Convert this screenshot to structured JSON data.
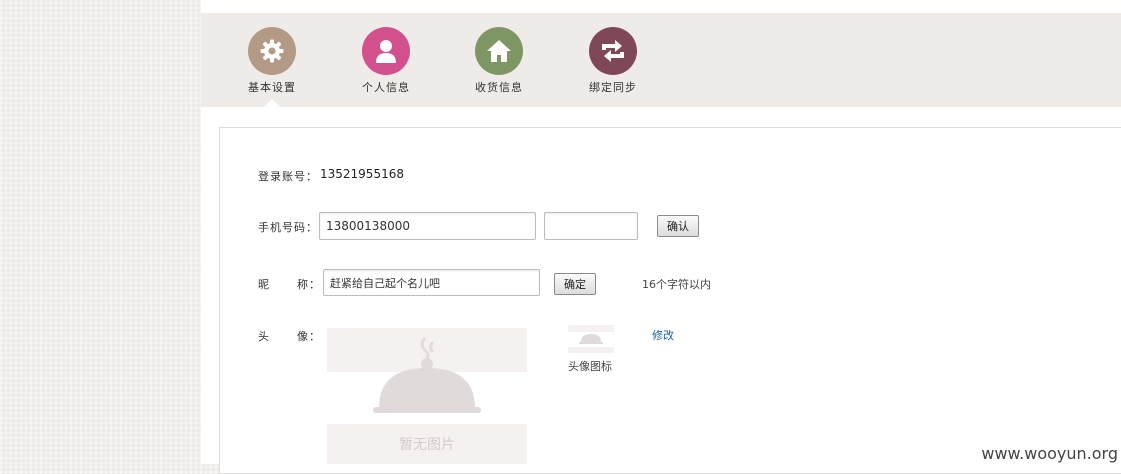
{
  "nav": {
    "items": [
      {
        "label": "基本设置",
        "icon": "gear-icon",
        "color": "#b29a86"
      },
      {
        "label": "个人信息",
        "icon": "user-icon",
        "color": "#d2508c"
      },
      {
        "label": "收货信息",
        "icon": "home-icon",
        "color": "#7d9663"
      },
      {
        "label": "绑定同步",
        "icon": "sync-icon",
        "color": "#7f4857"
      }
    ],
    "active": "基本设置"
  },
  "form": {
    "account_label": "登录账号：",
    "account_value": "13521955168",
    "phone_label": "手机号码：",
    "phone_value": "13800138000",
    "code_value": "",
    "confirm_label": "确认",
    "nickname_label": "昵      称：",
    "nickname_value": "赶紧给自己起个名儿吧",
    "nickname_button": "确定",
    "nickname_hint": "16个字符以内",
    "avatar_label": "头      像：",
    "avatar_placeholder": "暂无图片",
    "avatar_icon_label": "头像图标",
    "modify_link": "修改"
  },
  "watermark": "www.wooyun.org"
}
